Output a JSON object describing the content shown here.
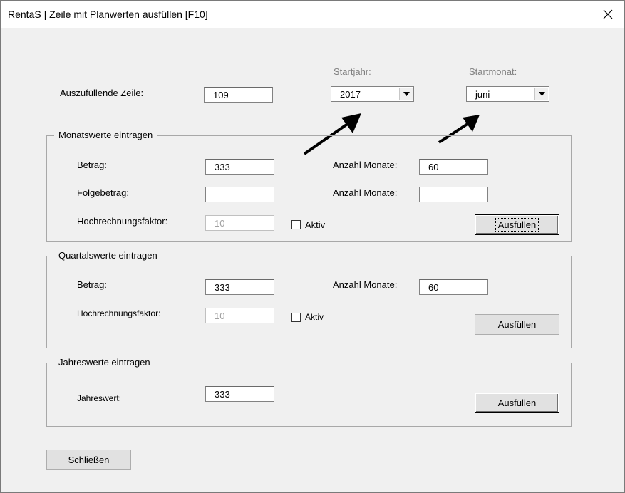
{
  "window": {
    "title": "RentaS | Zeile mit Planwerten ausfüllen [F10]"
  },
  "top": {
    "zeile_label": "Auszufüllende Zeile:",
    "zeile_value": "109",
    "startjahr_label": "Startjahr:",
    "startjahr_value": "2017",
    "startmonat_label": "Startmonat:",
    "startmonat_value": "juni"
  },
  "monat": {
    "title": "Monatswerte eintragen",
    "betrag_label": "Betrag:",
    "betrag_value": "333",
    "anzahl1_label": "Anzahl Monate:",
    "anzahl1_value": "60",
    "folge_label": "Folgebetrag:",
    "folge_value": "",
    "anzahl2_label": "Anzahl Monate:",
    "anzahl2_value": "",
    "hoch_label": "Hochrechnungsfaktor:",
    "hoch_value": "10",
    "aktiv_label": "Aktiv",
    "button": "Ausfüllen"
  },
  "quartal": {
    "title": "Quartalswerte eintragen",
    "betrag_label": "Betrag:",
    "betrag_value": "333",
    "anzahl_label": "Anzahl Monate:",
    "anzahl_value": "60",
    "hoch_label": "Hochrechnungsfaktor:",
    "hoch_value": "10",
    "aktiv_label": "Aktiv",
    "button": "Ausfüllen"
  },
  "jahr": {
    "title": "Jahreswerte eintragen",
    "wert_label": "Jahreswert:",
    "wert_value": "333",
    "button": "Ausfüllen"
  },
  "footer": {
    "close_button": "Schließen"
  },
  "icons": {
    "close": "close-icon",
    "dropdown": "chevron-down-icon",
    "annotation": "arrow-annotation-icon"
  },
  "colors": {
    "background": "#f0f0f0",
    "titlebar": "#ffffff",
    "border": "#a8a8a8"
  }
}
